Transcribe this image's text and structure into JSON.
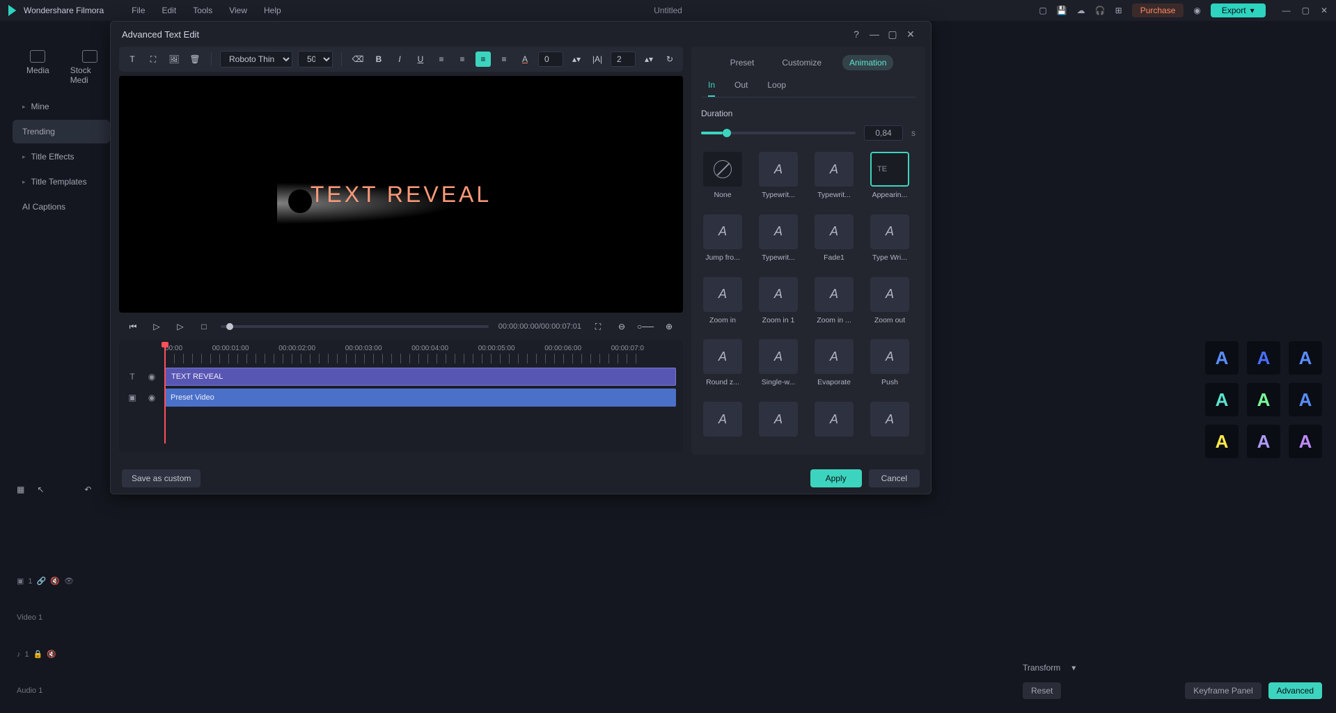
{
  "menubar": {
    "app_name": "Wondershare Filmora",
    "items": [
      "File",
      "Edit",
      "Tools",
      "View",
      "Help"
    ],
    "doc_title": "Untitled",
    "purchase": "Purchase",
    "export": "Export"
  },
  "sidebar": {
    "tabs": [
      "Media",
      "Stock Medi"
    ],
    "items": [
      {
        "label": "Mine",
        "expandable": true
      },
      {
        "label": "Trending",
        "active": true
      },
      {
        "label": "Title Effects",
        "expandable": true
      },
      {
        "label": "Title Templates",
        "expandable": true
      },
      {
        "label": "AI Captions"
      }
    ]
  },
  "timeline_bg": {
    "video_track": "Video 1",
    "audio_track": "Audio 1"
  },
  "modal": {
    "title": "Advanced Text Edit",
    "toolbar": {
      "font": "Roboto Thin",
      "size": "50",
      "spacing": "0",
      "line": "2"
    },
    "preview_text": "TEXT REVEAL",
    "timecode": "00:00:00:00/00:00:07:01",
    "mini_ruler": [
      "00:00",
      "00:00:01:00",
      "00:00:02:00",
      "00:00:03:00",
      "00:00:04:00",
      "00:00:05:00",
      "00:00:06:00",
      "00:00:07:0"
    ],
    "text_clip": "TEXT REVEAL",
    "video_clip": "Preset Video",
    "right_tabs": [
      "Preset",
      "Customize",
      "Animation"
    ],
    "sub_tabs": [
      "In",
      "Out",
      "Loop"
    ],
    "duration_label": "Duration",
    "duration_value": "0,84",
    "duration_unit": "s",
    "animations": [
      {
        "label": "None",
        "none": true
      },
      {
        "label": "Typewrit..."
      },
      {
        "label": "Typewrit..."
      },
      {
        "label": "Appearin...",
        "selected": true,
        "thumb": "TE"
      },
      {
        "label": "Jump fro..."
      },
      {
        "label": "Typewrit..."
      },
      {
        "label": "Fade1"
      },
      {
        "label": "Type Wri..."
      },
      {
        "label": "Zoom in"
      },
      {
        "label": "Zoom in 1"
      },
      {
        "label": "Zoom in ..."
      },
      {
        "label": "Zoom out"
      },
      {
        "label": "Round z..."
      },
      {
        "label": "Single-w..."
      },
      {
        "label": "Evaporate"
      },
      {
        "label": "Push"
      },
      {
        "label": ""
      },
      {
        "label": ""
      },
      {
        "label": ""
      },
      {
        "label": ""
      }
    ],
    "footer": {
      "save": "Save as custom",
      "apply": "Apply",
      "cancel": "Cancel"
    }
  },
  "inspector_bg": {
    "transform": "Transform",
    "reset": "Reset",
    "keyframe": "Keyframe Panel",
    "advanced": "Advanced",
    "style_colors": [
      "#5a8eff",
      "#4a6fff",
      "#5ae4cf",
      "#7aff9a",
      "#ffea4a",
      "#b09aff",
      "#c08aff"
    ]
  }
}
